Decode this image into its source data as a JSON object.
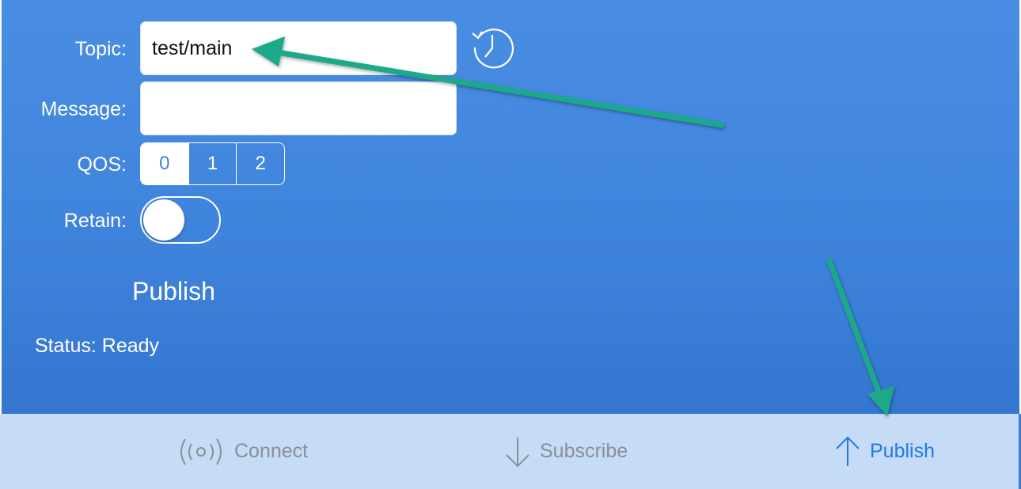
{
  "form": {
    "topic_label": "Topic:",
    "topic_value": "test/main",
    "message_label": "Message:",
    "message_value": "",
    "qos_label": "QOS:",
    "qos_options": [
      "0",
      "1",
      "2"
    ],
    "qos_selected": "0",
    "retain_label": "Retain:",
    "retain_on": false
  },
  "publish_button": "Publish",
  "status_text": "Status: Ready",
  "tabbar": {
    "connect": "Connect",
    "subscribe": "Subscribe",
    "publish": "Publish",
    "active": "publish"
  },
  "colors": {
    "background": "#4287e0",
    "tabbar": "#c6dbf5",
    "active_tab": "#1d7ce8",
    "annotation_arrow": "#1aa98a"
  },
  "icons": {
    "history": "history-clock-icon",
    "connect": "broadcast-icon",
    "subscribe": "arrow-down-icon",
    "publish": "arrow-up-icon"
  }
}
